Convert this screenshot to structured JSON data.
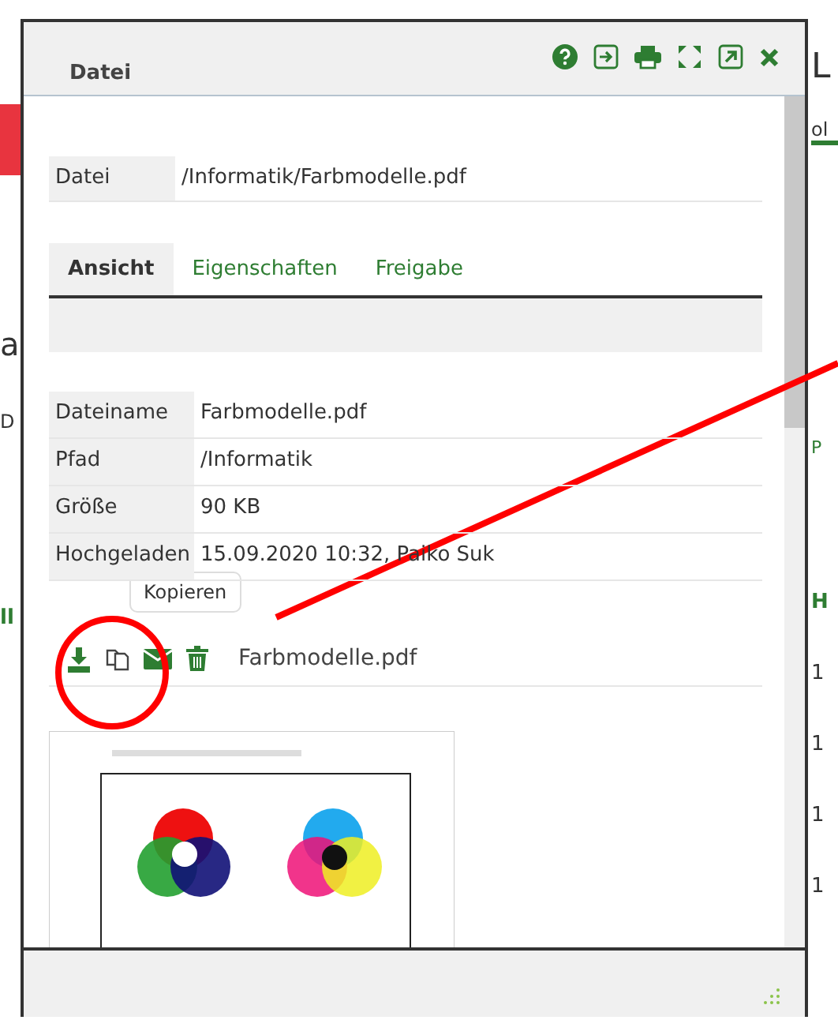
{
  "background": {
    "left": [
      {
        "kind": "heading",
        "text": "a"
      },
      {
        "kind": "label",
        "text": "D"
      },
      {
        "kind": "link",
        "text": "ll"
      }
    ],
    "right": [
      {
        "kind": "title",
        "text": "L"
      },
      {
        "kind": "tab",
        "text": "ol"
      },
      {
        "kind": "link",
        "text": "P"
      },
      {
        "kind": "header",
        "text": "H"
      },
      {
        "kind": "cell",
        "text": "1"
      },
      {
        "kind": "cell",
        "text": "1"
      },
      {
        "kind": "cell",
        "text": "1"
      },
      {
        "kind": "cell",
        "text": "1"
      }
    ]
  },
  "dialog": {
    "title": "Datei",
    "file": {
      "label": "Datei",
      "value": "/Informatik/Farbmodelle.pdf"
    },
    "tabs": [
      {
        "label": "Ansicht",
        "selected": true
      },
      {
        "label": "Eigenschaften",
        "selected": false
      },
      {
        "label": "Freigabe",
        "selected": false
      }
    ],
    "properties": [
      {
        "label": "Dateiname",
        "value": "Farbmodelle.pdf"
      },
      {
        "label": "Pfad",
        "value": "/Informatik"
      },
      {
        "label": "Größe",
        "value": "90 KB"
      },
      {
        "label": "Hochgeladen",
        "value": "15.09.2020 10:32, Paiko Suk"
      }
    ],
    "tooltip": "Kopieren",
    "filename": "Farbmodelle.pdf"
  }
}
